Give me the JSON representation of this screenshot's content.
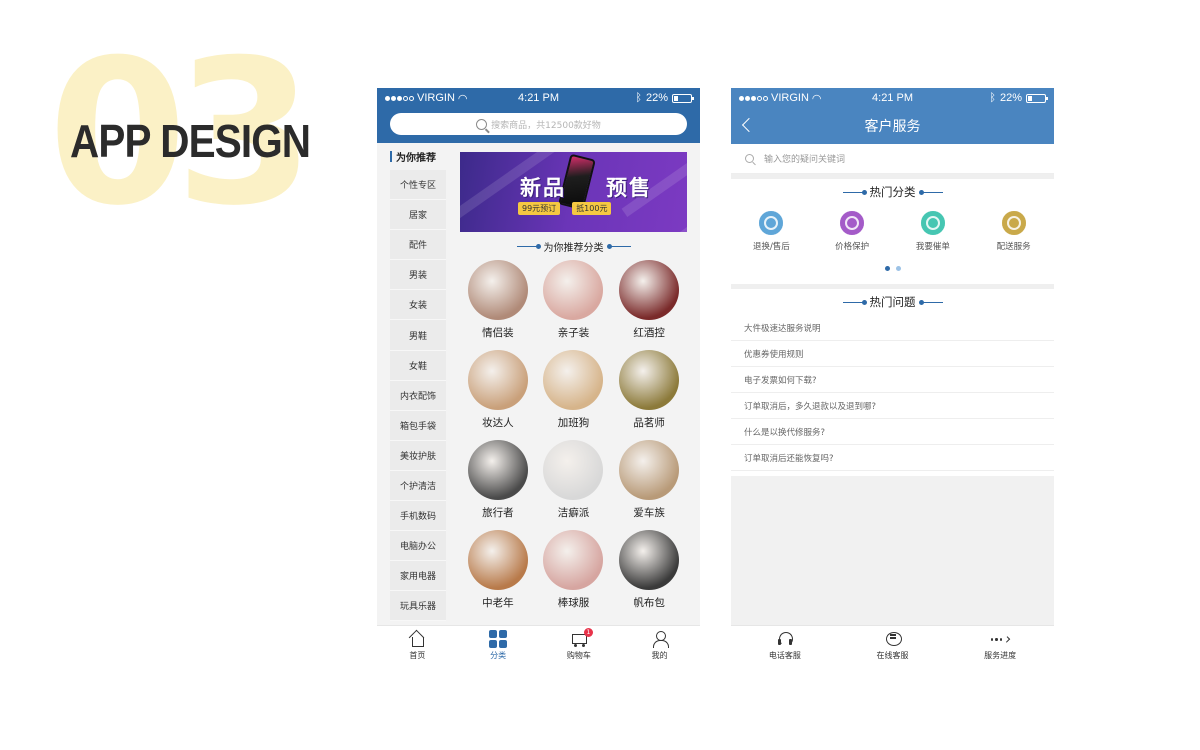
{
  "hero": {
    "number": "03",
    "title": "APP DESIGN"
  },
  "status_bar": {
    "carrier": "VIRGIN",
    "time": "4:21 PM",
    "battery": "22%"
  },
  "shop": {
    "search": {
      "placeholder": "搜索商品，共12500款好物"
    },
    "sidebar": {
      "heading": "为你推荐",
      "items": [
        "个性专区",
        "居家",
        "配件",
        "男装",
        "女装",
        "男鞋",
        "女鞋",
        "内衣配饰",
        "箱包手袋",
        "美妆护肤",
        "个护清洁",
        "手机数码",
        "电脑办公",
        "家用电器",
        "玩具乐器"
      ]
    },
    "banner": {
      "title_left": "新品",
      "title_right": "预售",
      "tag_left": "99元预订",
      "tag_right": "抵100元"
    },
    "section_title": "为你推荐分类",
    "categories": [
      {
        "label": "情侣装",
        "color": "#b08a78"
      },
      {
        "label": "亲子装",
        "color": "#d9a8a0"
      },
      {
        "label": "红酒控",
        "color": "#7a2a2a"
      },
      {
        "label": "妆达人",
        "color": "#c9a07a"
      },
      {
        "label": "加班狗",
        "color": "#d6b48a"
      },
      {
        "label": "品茗师",
        "color": "#8c7a3a"
      },
      {
        "label": "旅行者",
        "color": "#4a4a4a"
      },
      {
        "label": "洁癖派",
        "color": "#d8d8d8"
      },
      {
        "label": "爱车族",
        "color": "#b89a78"
      },
      {
        "label": "中老年",
        "color": "#b87a4a"
      },
      {
        "label": "棒球服",
        "color": "#d6a5a0"
      },
      {
        "label": "帆布包",
        "color": "#3a3a3a"
      }
    ],
    "tabbar": [
      {
        "label": "首页",
        "icon": "home-icon"
      },
      {
        "label": "分类",
        "icon": "category-grid-icon"
      },
      {
        "label": "购物车",
        "icon": "cart-icon",
        "badge": "1"
      },
      {
        "label": "我的",
        "icon": "user-icon"
      }
    ]
  },
  "service": {
    "title": "客户服务",
    "search_placeholder": "输入您的疑问关键词",
    "hot_categories_title": "热门分类",
    "categories": [
      {
        "label": "退换/售后",
        "icon": "refresh-icon",
        "color": "#5fa6d8"
      },
      {
        "label": "价格保护",
        "icon": "shield-icon",
        "color": "#a45bc8"
      },
      {
        "label": "我要催单",
        "icon": "bell-icon",
        "color": "#46c6b2"
      },
      {
        "label": "配送服务",
        "icon": "delivery-icon",
        "color": "#c9a94a"
      }
    ],
    "hot_questions_title": "热门问题",
    "questions": [
      "大件极速达服务说明",
      "优惠券使用规则",
      "电子发票如何下载?",
      "订单取消后，多久退款以及退到哪?",
      "什么是以换代修服务?",
      "订单取消后还能恢复吗?"
    ],
    "tabbar": [
      {
        "label": "电话客服",
        "icon": "headset-icon"
      },
      {
        "label": "在线客服",
        "icon": "chat-icon"
      },
      {
        "label": "服务进度",
        "icon": "more-icon"
      }
    ]
  },
  "colors": {
    "shop_header": "#2e6aa8",
    "service_header": "#4a85c0",
    "badge": "#e8334a"
  }
}
